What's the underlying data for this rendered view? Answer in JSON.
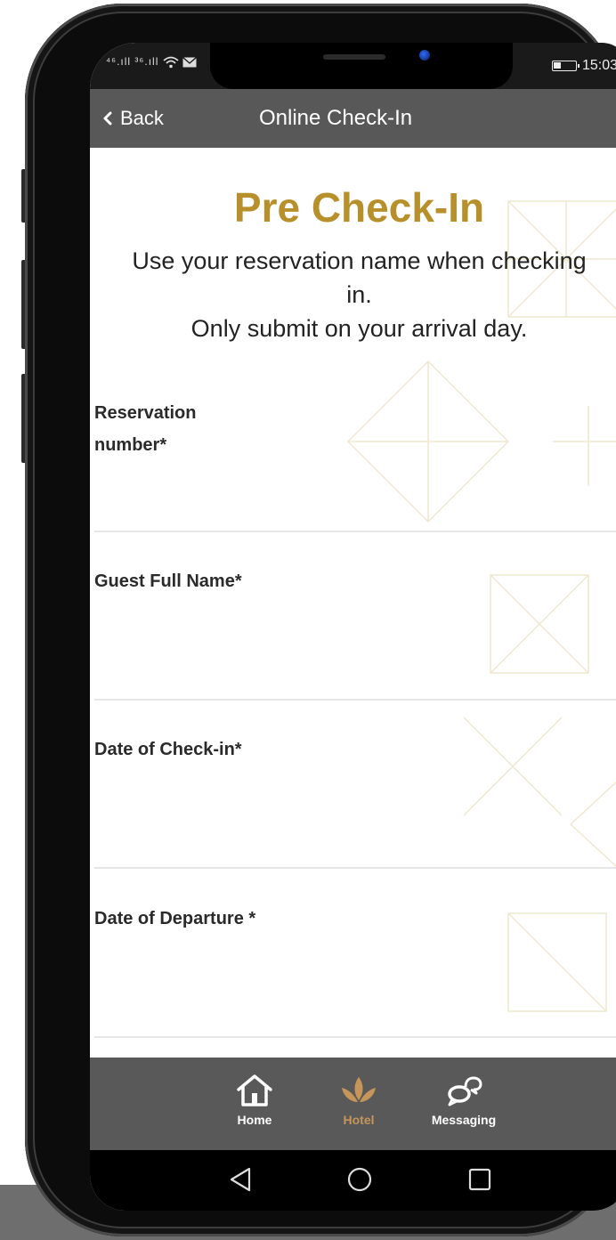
{
  "status_bar": {
    "time": "15:03",
    "signal_text": "⁴⁶.ıll ³⁶.ıll"
  },
  "header": {
    "back_label": "Back",
    "title": "Online Check-In"
  },
  "hero": {
    "title": "Pre Check-In",
    "subtitle_line1": "Use your reservation name when checking in.",
    "subtitle_line2": "Only submit on your arrival day."
  },
  "form": {
    "fields": [
      {
        "label": "Reservation number*",
        "value": ""
      },
      {
        "label": "Guest Full Name*",
        "value": ""
      },
      {
        "label": "Date of Check-in*",
        "value": ""
      },
      {
        "label": "Date of Departure *",
        "value": ""
      }
    ]
  },
  "tabbar": {
    "tabs": [
      {
        "label": "Home",
        "icon": "home-icon",
        "active": false
      },
      {
        "label": "Hotel",
        "icon": "lotus-icon",
        "active": true
      },
      {
        "label": "Messaging",
        "icon": "chat-bubbles-icon",
        "active": false
      }
    ]
  },
  "colors": {
    "accent_gold": "#b8902b",
    "tab_active": "#c5955a",
    "header_bg": "#585858",
    "tabbar_bg": "#595959"
  }
}
